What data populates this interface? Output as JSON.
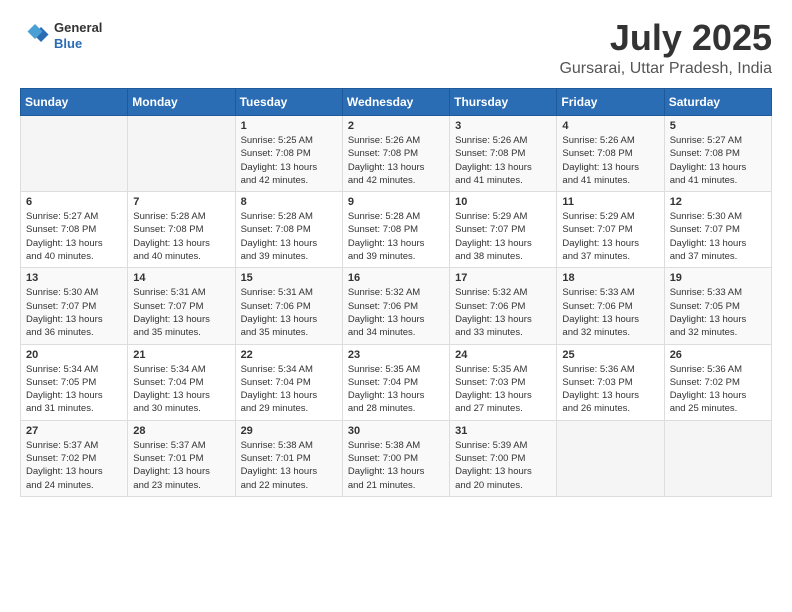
{
  "header": {
    "logo_line1": "General",
    "logo_line2": "Blue",
    "month_year": "July 2025",
    "location": "Gursarai, Uttar Pradesh, India"
  },
  "weekdays": [
    "Sunday",
    "Monday",
    "Tuesday",
    "Wednesday",
    "Thursday",
    "Friday",
    "Saturday"
  ],
  "weeks": [
    [
      {
        "day": "",
        "info": ""
      },
      {
        "day": "",
        "info": ""
      },
      {
        "day": "1",
        "info": "Sunrise: 5:25 AM\nSunset: 7:08 PM\nDaylight: 13 hours\nand 42 minutes."
      },
      {
        "day": "2",
        "info": "Sunrise: 5:26 AM\nSunset: 7:08 PM\nDaylight: 13 hours\nand 42 minutes."
      },
      {
        "day": "3",
        "info": "Sunrise: 5:26 AM\nSunset: 7:08 PM\nDaylight: 13 hours\nand 41 minutes."
      },
      {
        "day": "4",
        "info": "Sunrise: 5:26 AM\nSunset: 7:08 PM\nDaylight: 13 hours\nand 41 minutes."
      },
      {
        "day": "5",
        "info": "Sunrise: 5:27 AM\nSunset: 7:08 PM\nDaylight: 13 hours\nand 41 minutes."
      }
    ],
    [
      {
        "day": "6",
        "info": "Sunrise: 5:27 AM\nSunset: 7:08 PM\nDaylight: 13 hours\nand 40 minutes."
      },
      {
        "day": "7",
        "info": "Sunrise: 5:28 AM\nSunset: 7:08 PM\nDaylight: 13 hours\nand 40 minutes."
      },
      {
        "day": "8",
        "info": "Sunrise: 5:28 AM\nSunset: 7:08 PM\nDaylight: 13 hours\nand 39 minutes."
      },
      {
        "day": "9",
        "info": "Sunrise: 5:28 AM\nSunset: 7:08 PM\nDaylight: 13 hours\nand 39 minutes."
      },
      {
        "day": "10",
        "info": "Sunrise: 5:29 AM\nSunset: 7:07 PM\nDaylight: 13 hours\nand 38 minutes."
      },
      {
        "day": "11",
        "info": "Sunrise: 5:29 AM\nSunset: 7:07 PM\nDaylight: 13 hours\nand 37 minutes."
      },
      {
        "day": "12",
        "info": "Sunrise: 5:30 AM\nSunset: 7:07 PM\nDaylight: 13 hours\nand 37 minutes."
      }
    ],
    [
      {
        "day": "13",
        "info": "Sunrise: 5:30 AM\nSunset: 7:07 PM\nDaylight: 13 hours\nand 36 minutes."
      },
      {
        "day": "14",
        "info": "Sunrise: 5:31 AM\nSunset: 7:07 PM\nDaylight: 13 hours\nand 35 minutes."
      },
      {
        "day": "15",
        "info": "Sunrise: 5:31 AM\nSunset: 7:06 PM\nDaylight: 13 hours\nand 35 minutes."
      },
      {
        "day": "16",
        "info": "Sunrise: 5:32 AM\nSunset: 7:06 PM\nDaylight: 13 hours\nand 34 minutes."
      },
      {
        "day": "17",
        "info": "Sunrise: 5:32 AM\nSunset: 7:06 PM\nDaylight: 13 hours\nand 33 minutes."
      },
      {
        "day": "18",
        "info": "Sunrise: 5:33 AM\nSunset: 7:06 PM\nDaylight: 13 hours\nand 32 minutes."
      },
      {
        "day": "19",
        "info": "Sunrise: 5:33 AM\nSunset: 7:05 PM\nDaylight: 13 hours\nand 32 minutes."
      }
    ],
    [
      {
        "day": "20",
        "info": "Sunrise: 5:34 AM\nSunset: 7:05 PM\nDaylight: 13 hours\nand 31 minutes."
      },
      {
        "day": "21",
        "info": "Sunrise: 5:34 AM\nSunset: 7:04 PM\nDaylight: 13 hours\nand 30 minutes."
      },
      {
        "day": "22",
        "info": "Sunrise: 5:34 AM\nSunset: 7:04 PM\nDaylight: 13 hours\nand 29 minutes."
      },
      {
        "day": "23",
        "info": "Sunrise: 5:35 AM\nSunset: 7:04 PM\nDaylight: 13 hours\nand 28 minutes."
      },
      {
        "day": "24",
        "info": "Sunrise: 5:35 AM\nSunset: 7:03 PM\nDaylight: 13 hours\nand 27 minutes."
      },
      {
        "day": "25",
        "info": "Sunrise: 5:36 AM\nSunset: 7:03 PM\nDaylight: 13 hours\nand 26 minutes."
      },
      {
        "day": "26",
        "info": "Sunrise: 5:36 AM\nSunset: 7:02 PM\nDaylight: 13 hours\nand 25 minutes."
      }
    ],
    [
      {
        "day": "27",
        "info": "Sunrise: 5:37 AM\nSunset: 7:02 PM\nDaylight: 13 hours\nand 24 minutes."
      },
      {
        "day": "28",
        "info": "Sunrise: 5:37 AM\nSunset: 7:01 PM\nDaylight: 13 hours\nand 23 minutes."
      },
      {
        "day": "29",
        "info": "Sunrise: 5:38 AM\nSunset: 7:01 PM\nDaylight: 13 hours\nand 22 minutes."
      },
      {
        "day": "30",
        "info": "Sunrise: 5:38 AM\nSunset: 7:00 PM\nDaylight: 13 hours\nand 21 minutes."
      },
      {
        "day": "31",
        "info": "Sunrise: 5:39 AM\nSunset: 7:00 PM\nDaylight: 13 hours\nand 20 minutes."
      },
      {
        "day": "",
        "info": ""
      },
      {
        "day": "",
        "info": ""
      }
    ]
  ]
}
